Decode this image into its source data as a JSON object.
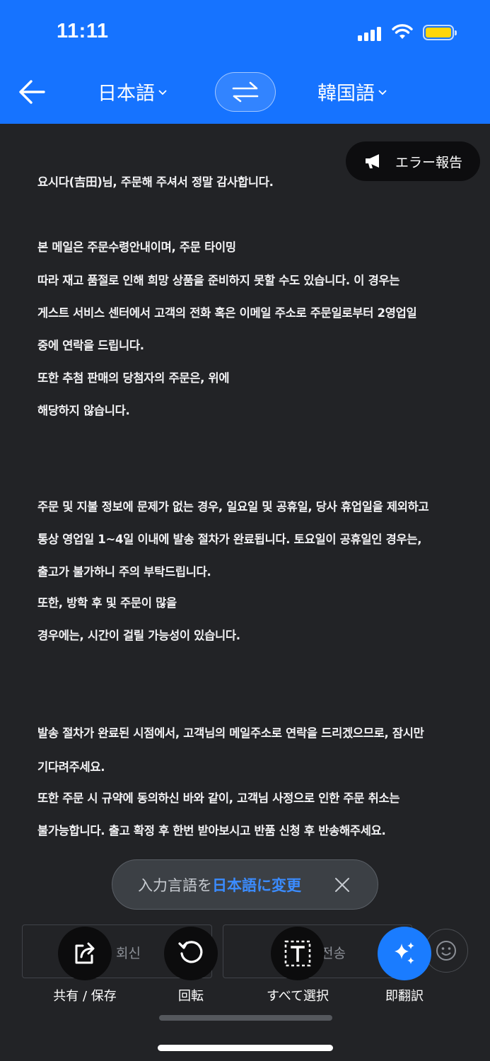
{
  "status_bar": {
    "time": "11:11"
  },
  "header": {
    "source_language": "日本語",
    "target_language": "韓国語",
    "back_icon": "arrow-left-icon",
    "swap_icon": "swap-arrows-icon"
  },
  "report_button": {
    "label": "エラー報告",
    "icon": "megaphone-icon"
  },
  "translation_lines": [
    "요시다(吉田)님, 주문해 주셔서 정말 감사합니다.",
    "본 메일은 주문수령안내이며, 주문 타이밍",
    "따라 재고 품절로 인해 희망 상품을 준비하지 못할 수도 있습니다. 이 경우는",
    "게스트 서비스 센터에서 고객의 전화 혹은 이메일 주소로 주문일로부터 2영업일",
    "중에 연락을 드립니다.",
    "또한 추첨 판매의 당첨자의 주문은, 위에",
    "해당하지 않습니다.",
    "주문 및 지불 정보에 문제가 없는 경우, 일요일 및 공휴일, 당사 휴업일을 제외하고",
    "통상 영업일 1~4일 이내에 발송 절차가 완료됩니다. 토요일이 공휴일인 경우는,",
    "출고가 불가하니 주의 부탁드립니다.",
    "또한, 방학 후 및 주문이 많을",
    "경우에는, 시간이 걸릴 가능성이 있습니다.",
    "발송 절차가 완료된 시점에서, 고객님의 메일주소로 연락을 드리겠으므로, 잠시만",
    "기다려주세요.",
    "또한 주문 시 규약에 동의하신 바와 같이, 고객님 사정으로 인한 주문 취소는",
    "불가능합니다. 출고 확정 후 한번 받아보시고 반품 신청 후 반송해주세요."
  ],
  "toast": {
    "prefix": "入力言語を",
    "highlight": "日本語に変更",
    "close_icon": "close-icon"
  },
  "background_buttons": {
    "reply": "회신",
    "send": "전송"
  },
  "actions": {
    "share": {
      "label": "共有 / 保存",
      "icon": "share-icon"
    },
    "rotate": {
      "label": "回転",
      "icon": "rotate-icon"
    },
    "select_all": {
      "label": "すべて選択",
      "icon": "select-text-icon"
    },
    "instant": {
      "label": "即翻訳",
      "icon": "sparkles-icon"
    }
  },
  "colors": {
    "header_blue": "#1673ff",
    "accent": "#1a7cff",
    "content_bg": "#222326"
  }
}
